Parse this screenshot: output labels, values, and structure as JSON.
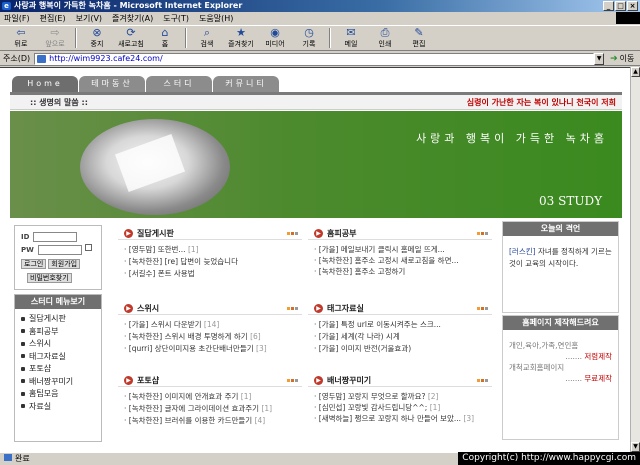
{
  "window": {
    "title": "사랑과 행복이 가득한 녹차홈 - Microsoft Internet Explorer",
    "buttons": [
      "_",
      "□",
      "×"
    ]
  },
  "menubar": [
    "파일(F)",
    "편집(E)",
    "보기(V)",
    "즐겨찾기(A)",
    "도구(T)",
    "도움말(H)"
  ],
  "toolbar": [
    {
      "label": "뒤로",
      "icon": "back-arrow-icon",
      "glyph": "⇦",
      "disabled": false
    },
    {
      "label": "앞으로",
      "icon": "forward-arrow-icon",
      "glyph": "⇨",
      "disabled": true
    },
    {
      "label": "중지",
      "icon": "stop-icon",
      "glyph": "⊗",
      "disabled": false
    },
    {
      "label": "새로고침",
      "icon": "refresh-icon",
      "glyph": "⟳",
      "disabled": false
    },
    {
      "label": "홈",
      "icon": "home-icon",
      "glyph": "⌂",
      "disabled": false
    },
    {
      "label": "검색",
      "icon": "search-icon",
      "glyph": "⌕",
      "disabled": false
    },
    {
      "label": "즐겨찾기",
      "icon": "favorites-icon",
      "glyph": "★",
      "disabled": false
    },
    {
      "label": "미디어",
      "icon": "media-icon",
      "glyph": "◉",
      "disabled": false
    },
    {
      "label": "기록",
      "icon": "history-icon",
      "glyph": "◷",
      "disabled": false
    },
    {
      "label": "메일",
      "icon": "mail-icon",
      "glyph": "✉",
      "disabled": false
    },
    {
      "label": "인쇄",
      "icon": "print-icon",
      "glyph": "⎙",
      "disabled": false
    },
    {
      "label": "편집",
      "icon": "edit-icon",
      "glyph": "✎",
      "disabled": false
    }
  ],
  "address": {
    "label": "주소(D)",
    "url": "http://wim9923.cafe24.com/",
    "go_label": "이동"
  },
  "site": {
    "tabs": [
      "Home",
      "테마동산",
      "스터디",
      "커뮤니티"
    ],
    "subbar_label": "::  생명의 말씀  ::",
    "quote": "심령이 가난한 자는 복이 있나니 천국이 저희",
    "slogan": "사랑과 행복이 가득한 녹차홈",
    "study": "03 STUDY",
    "login": {
      "id_label": "ID",
      "pw_label": "PW",
      "login_button": "로그인",
      "join_button": "회원가입",
      "find_pw_button": "비밀번호찾기"
    },
    "study_menu": {
      "title": "스터디 메뉴보기",
      "items": [
        "질답게시판",
        "홈피공부",
        "스위시",
        "태그자료실",
        "포토샵",
        "배너짱꾸미기",
        "홈팁모음",
        "자료실"
      ]
    },
    "boards": [
      {
        "title": "질답게시판",
        "posts": [
          {
            "text": "[영두맘] 또한번...",
            "count": "[1]"
          },
          {
            "text": "[녹차한잔] [re] 답변이 늦었습니다",
            "count": ""
          },
          {
            "text": "[서길수] 폰트 사용법",
            "count": ""
          }
        ]
      },
      {
        "title": "홈피공부",
        "posts": [
          {
            "text": "[가을] 메일보내기 클릭시 홈메일 뜨게...",
            "count": ""
          },
          {
            "text": "[녹차한잔] 홈주소 고정시 새로고침을 하면...",
            "count": ""
          },
          {
            "text": "[녹차한잔] 홈주소 고정하기",
            "count": ""
          }
        ]
      },
      {
        "title": "스위시",
        "posts": [
          {
            "text": "[가을] 스위시 다운받기",
            "count": "[14]"
          },
          {
            "text": "[녹차한잔] 스위시 배경 투명하게 하기",
            "count": "[6]"
          },
          {
            "text": "[qurri] 상단이미지용 초간단배너만들기",
            "count": "[3]"
          }
        ]
      },
      {
        "title": "태그자료실",
        "posts": [
          {
            "text": "[가을] 특정 url로 이동시켜주는 스크...",
            "count": ""
          },
          {
            "text": "[가을] 세계(각 나라) 시계",
            "count": ""
          },
          {
            "text": "[가을] 이미지 반전(거울효과)",
            "count": ""
          }
        ]
      },
      {
        "title": "포토샵",
        "posts": [
          {
            "text": "[녹차한잔] 이미지에 안개효과 주기",
            "count": "[1]"
          },
          {
            "text": "[녹차한잔] 글자에 그라이데이션 효과주기",
            "count": "[1]"
          },
          {
            "text": "[녹차한잔] 브러쉬를 이용한 카드만들기",
            "count": "[4]"
          }
        ]
      },
      {
        "title": "배너짱꾸미기",
        "posts": [
          {
            "text": "[영두맘] 꼬랑지 무엇으로 할까요?",
            "count": "[2]"
          },
          {
            "text": "[심민섭] 꼬랑빛 감사드립니당^^;",
            "count": "[1]"
          },
          {
            "text": "[새벽하늘] 쩡으로 꼬랑지 하나 만들어 보았...",
            "count": "[3]"
          }
        ]
      }
    ],
    "today_quote": {
      "title": "오늘의 격언",
      "author": "[러스킨]",
      "text": " 자녀를 정직하게 기르는 것이 교육의 시작이다."
    },
    "homepage_box": {
      "title": "홈페이지 제작해드려요",
      "line1": "개인,육아,가족,연인홈",
      "line1b": "....... ",
      "line1c": "저렴제작",
      "line2": "개척교회홈페이지",
      "line2b": "....... ",
      "line2c": "무료제작"
    }
  },
  "status": {
    "text": "완료",
    "copyright": "Copyright(c) http://www.happycgi.com"
  }
}
